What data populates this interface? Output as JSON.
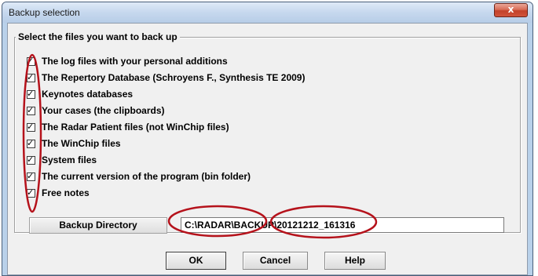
{
  "window": {
    "title": "Backup selection",
    "close_symbol": "x"
  },
  "group": {
    "legend": "Select the files you want to back up",
    "items": [
      {
        "label": "The log files with your personal additions",
        "checked": true
      },
      {
        "label": "The Repertory Database (Schroyens F., Synthesis TE 2009)",
        "checked": true
      },
      {
        "label": "Keynotes databases",
        "checked": true
      },
      {
        "label": "Your cases (the clipboards)",
        "checked": true
      },
      {
        "label": "The Radar Patient files (not WinChip files)",
        "checked": true
      },
      {
        "label": "The WinChip files",
        "checked": true
      },
      {
        "label": "System files",
        "checked": true
      },
      {
        "label": "The current version of the program (bin folder)",
        "checked": true
      },
      {
        "label": "Free notes",
        "checked": true
      }
    ],
    "check_symbol": "✓"
  },
  "backup": {
    "button_label": "Backup Directory",
    "path_value": "C:\\RADAR\\BACKUP\\20121212_161316"
  },
  "buttons": {
    "ok": "OK",
    "cancel": "Cancel",
    "help": "Help"
  },
  "colors": {
    "annotation_red": "#b5121b",
    "frame": "#b9d1ea"
  }
}
